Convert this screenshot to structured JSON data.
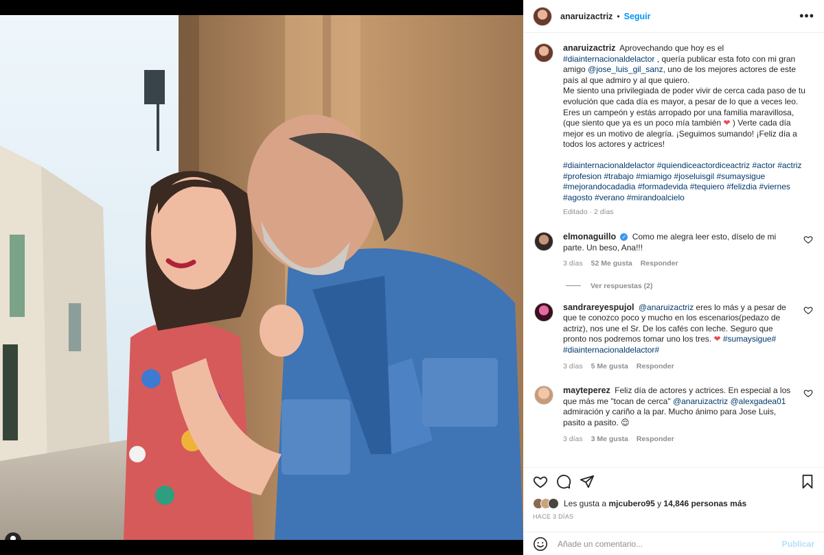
{
  "post": {
    "author": "anaruizactriz",
    "follow_label": "Seguir",
    "caption": {
      "text_1": "Aprovechando que hoy es el ",
      "tag_1": "#diainternacionaldelactor",
      "text_2": " , quería publicar esta foto con mi gran amigo ",
      "mention_1": "@jose_luis_gil_sanz",
      "text_3": ", uno de los mejores actores de este país al que admiro y al que quiero.",
      "paragraph_2": "Me siento una privilegiada de poder vivir de cerca cada paso de tu evolución que cada día es mayor, a pesar de lo que a veces leo.",
      "paragraph_3a": "Eres un campeón y estás arropado por una familia maravillosa, (que siento que ya es un poco mía también ",
      "paragraph_3b": " ) Verte cada día mejor es un motivo de alegría. ¡Seguimos sumando! ¡Feliz día a todos los actores y actrices!",
      "hashtags": "#diainternacionaldelactor #quiendiceactordiceactriz #actor #actriz #profesion #trabajo #miamigo #joseluisgil #sumaysigue #mejorandocadadia #formadevida #tequiero #felizdia #viernes #agosto #verano #mirandoalcielo",
      "edited": "Editado · 2 días"
    },
    "likes_prefix": "Les gusta a ",
    "likes_user": "mjcubero95",
    "likes_mid": " y ",
    "likes_count": "14,846 personas más",
    "time_ago": "HACE 3 DÍAS",
    "comment_placeholder": "Añade un comentario...",
    "publish_label": "Publicar"
  },
  "comments": [
    {
      "user": "elmonaguillo",
      "verified_mark": "✓",
      "text": "Como me alegra leer esto, díselo de mi parte. Un beso, Ana!!!",
      "time": "3 días",
      "likes": "52 Me gusta",
      "reply": "Responder",
      "view_replies": "Ver respuestas (2)"
    },
    {
      "user": "sandrareyespujol",
      "mention": "@anaruizactriz",
      "text_a": " eres lo más y a pesar de que te conozco poco y mucho en los escenarios(pedazo de actriz), nos une el Sr. De los cafés con leche. Seguro que pronto nos podremos tomar uno los tres. ",
      "tag_a": "#sumaysigue#",
      "tag_b": "#diainternacionaldelactor#",
      "time": "3 días",
      "likes": "5 Me gusta",
      "reply": "Responder"
    },
    {
      "user": "mayteperez",
      "text_a": "Feliz día de actores y actrices. En especial a los que más me \"tocan de cerca\" ",
      "mention_a": "@anaruizactriz",
      "mention_b": "@alexgadea01",
      "text_b": " admiración y cariño a la par. Mucho ánimo para Jose Luis, pasito a pasito. ",
      "emoji": "😌",
      "time": "3 días",
      "likes": "3 Me gusta",
      "reply": "Responder"
    }
  ],
  "colors": {
    "link": "#00376b",
    "follow": "#0095f6",
    "muted": "#8e8e8e",
    "heart": "#ed4956"
  }
}
